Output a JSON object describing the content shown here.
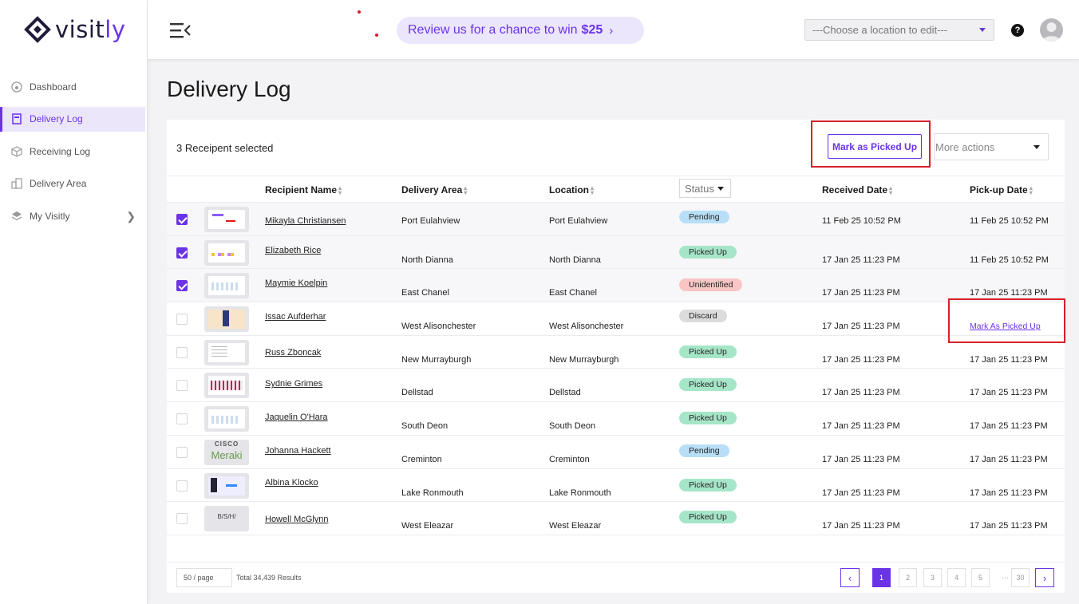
{
  "brand": {
    "name_a": "visit",
    "name_b": "ly"
  },
  "sidebar": {
    "items": [
      {
        "label": "Dashboard",
        "icon": "dashboard-icon",
        "active": false
      },
      {
        "label": "Delivery Log",
        "icon": "book-icon",
        "active": true
      },
      {
        "label": "Receiving Log",
        "icon": "box-icon",
        "active": false
      },
      {
        "label": "Delivery Area",
        "icon": "building-icon",
        "active": false
      },
      {
        "label": "My Visitly",
        "icon": "layers-icon",
        "active": false
      }
    ]
  },
  "topbar": {
    "promo_text": "Review us for a chance to win",
    "promo_amount": "$25",
    "location_placeholder": "---Choose a location to edit---",
    "help_label": "?"
  },
  "page": {
    "title": "Delivery Log"
  },
  "toolbar": {
    "selected_text": "3 Receipent selected",
    "mark_button": "Mark as Picked Up",
    "more_actions": "More actions"
  },
  "table": {
    "headers": {
      "name": "Recipient Name",
      "area": "Delivery Area",
      "location": "Location",
      "status": "Status",
      "received": "Received Date",
      "pickup": "Pick-up Date"
    },
    "rows": [
      {
        "checked": true,
        "name": "Mikayla Christiansen",
        "area": "Port Eulahview",
        "location": "Port Eulahview",
        "status": "Pending",
        "received": "11 Feb 25 10:52 PM",
        "pickup": "11 Feb 25 10:52 PM"
      },
      {
        "checked": true,
        "name": "Elizabeth Rice",
        "area": "North Dianna",
        "location": "North Dianna",
        "status": "Picked Up",
        "received": "17 Jan 25 11:23 PM",
        "pickup": "11 Feb 25 10:52 PM"
      },
      {
        "checked": true,
        "name": "Maymie Koelpin",
        "area": "East Chanel",
        "location": "East Chanel",
        "status": "Unidentified",
        "received": "17 Jan 25 11:23 PM",
        "pickup": "17 Jan 25 11:23 PM"
      },
      {
        "checked": false,
        "name": "Issac Aufderhar",
        "area": "West Alisonchester",
        "location": "West Alisonchester",
        "status": "Discard",
        "received": "17 Jan 25 11:23 PM",
        "pickup": "Mark As Picked Up"
      },
      {
        "checked": false,
        "name": "Russ Zboncak",
        "area": "New Murrayburgh",
        "location": "New Murrayburgh",
        "status": "Picked Up",
        "received": "17 Jan 25 11:23 PM",
        "pickup": "17 Jan 25 11:23 PM"
      },
      {
        "checked": false,
        "name": "Sydnie Grimes",
        "area": "Dellstad",
        "location": "Dellstad",
        "status": "Picked Up",
        "received": "17 Jan 25 11:23 PM",
        "pickup": "17 Jan 25 11:23 PM"
      },
      {
        "checked": false,
        "name": "Jaquelin O'Hara",
        "area": "South Deon",
        "location": "South Deon",
        "status": "Picked Up",
        "received": "17 Jan 25 11:23 PM",
        "pickup": "17 Jan 25 11:23 PM"
      },
      {
        "checked": false,
        "name": "Johanna Hackett",
        "area": "Creminton",
        "location": "Creminton",
        "status": "Pending",
        "received": "17 Jan 25 11:23 PM",
        "pickup": "17 Jan 25 11:23 PM"
      },
      {
        "checked": false,
        "name": "Albina Klocko",
        "area": "Lake Ronmouth",
        "location": "Lake Ronmouth",
        "status": "Picked Up",
        "received": "17 Jan 25 11:23 PM",
        "pickup": "17 Jan 25 11:23 PM"
      },
      {
        "checked": false,
        "name": "Howell McGlynn",
        "area": "West Eleazar",
        "location": "West Eleazar",
        "status": "Picked Up",
        "received": "17 Jan 25 11:23 PM",
        "pickup": "17 Jan 25 11:23 PM"
      }
    ],
    "thumb_texts": {
      "cisco": "CISCO",
      "meraki": "Meraki",
      "bsh": "B/S/H/"
    }
  },
  "pagination": {
    "page_size": "50 / page",
    "total": "Total 34,439 Results",
    "pages": [
      "1",
      "2",
      "3",
      "4",
      "5",
      "···",
      "30"
    ],
    "current": "1",
    "prev_icon": "chevron-left-icon",
    "next_icon": "chevron-right-icon"
  },
  "colors": {
    "accent": "#6a34e6",
    "highlight": "#d8202a"
  }
}
